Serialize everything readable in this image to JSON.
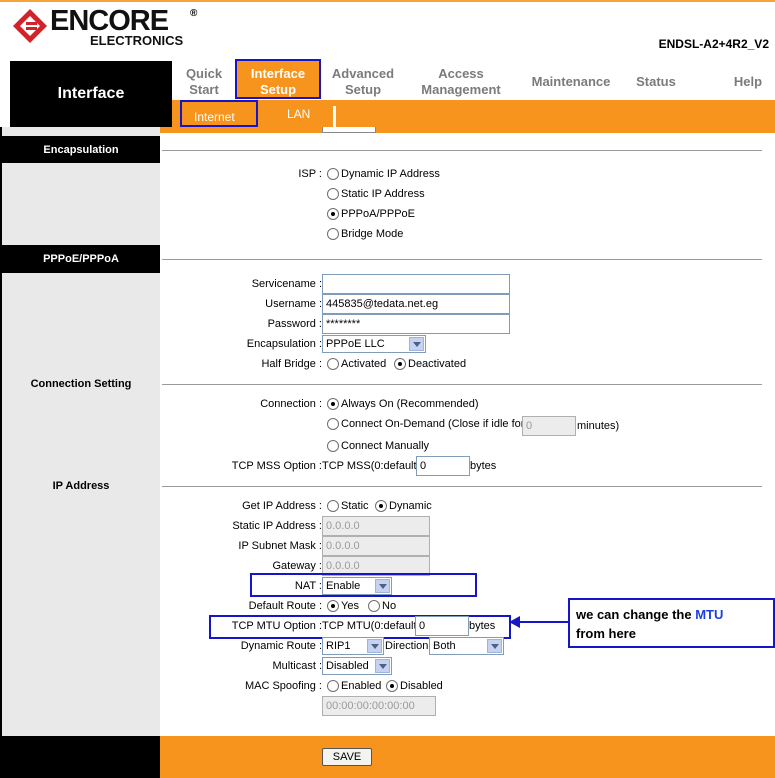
{
  "header": {
    "logo_main": "ENCORE",
    "logo_sub": "ELECTRONICS",
    "logo_reg": "®",
    "model": "ENDSL-A2+4R2_V2"
  },
  "nav": {
    "section_title": "Interface",
    "items": [
      {
        "label1": "Quick",
        "label2": "Start"
      },
      {
        "label1": "Interface",
        "label2": "Setup"
      },
      {
        "label1": "Advanced",
        "label2": "Setup"
      },
      {
        "label1": "Access",
        "label2": "Management"
      },
      {
        "label1": "Maintenance",
        "label2": ""
      },
      {
        "label1": "Status",
        "label2": ""
      },
      {
        "label1": "Help",
        "label2": ""
      }
    ],
    "subitems": [
      "Internet",
      "LAN"
    ]
  },
  "sections": {
    "encapsulation": "Encapsulation",
    "pppoe": "PPPoE/PPPoA",
    "connection_setting": "Connection Setting",
    "ip_address": "IP Address"
  },
  "isp": {
    "label": "ISP :",
    "options": [
      "Dynamic IP Address",
      "Static IP Address",
      "PPPoA/PPPoE",
      "Bridge Mode"
    ],
    "selected": "PPPoA/PPPoE"
  },
  "pppoe": {
    "servicename_label": "Servicename :",
    "servicename_value": "",
    "username_label": "Username :",
    "username_value": "445835@tedata.net.eg",
    "password_label": "Password :",
    "password_value": "********",
    "encap_label": "Encapsulation :",
    "encap_value": "PPPoE LLC",
    "halfbridge_label": "Half Bridge :",
    "halfbridge_options": [
      "Activated",
      "Deactivated"
    ],
    "halfbridge_selected": "Deactivated"
  },
  "connection": {
    "label": "Connection :",
    "always_on": "Always On (Recommended)",
    "on_demand_pre": "Connect On-Demand (Close if idle for",
    "on_demand_value": "0",
    "on_demand_post": "minutes)",
    "manual": "Connect Manually",
    "selected": "Always On (Recommended)",
    "mss_label": "TCP MSS Option :",
    "mss_pre": "TCP MSS(0:default)",
    "mss_value": "0",
    "mss_unit": "bytes"
  },
  "ip": {
    "get_ip_label": "Get IP Address :",
    "get_ip_options": [
      "Static",
      "Dynamic"
    ],
    "get_ip_selected": "Dynamic",
    "static_ip_label": "Static IP Address :",
    "static_ip_value": "0.0.0.0",
    "subnet_label": "IP Subnet Mask :",
    "subnet_value": "0.0.0.0",
    "gateway_label": "Gateway :",
    "gateway_value": "0.0.0.0",
    "nat_label": "NAT :",
    "nat_value": "Enable",
    "default_route_label": "Default Route :",
    "default_route_options": [
      "Yes",
      "No"
    ],
    "default_route_selected": "Yes",
    "mtu_label": "TCP MTU Option :",
    "mtu_pre": "TCP MTU(0:default)",
    "mtu_value": "0",
    "mtu_unit": "bytes",
    "dyn_route_label": "Dynamic Route :",
    "dyn_route_value": "RIP1",
    "direction_label": "Direction",
    "direction_value": "Both",
    "multicast_label": "Multicast :",
    "multicast_value": "Disabled",
    "mac_label": "MAC Spoofing :",
    "mac_options": [
      "Enabled",
      "Disabled"
    ],
    "mac_selected": "Disabled",
    "mac_value": "00:00:00:00:00:00"
  },
  "callout": {
    "line1": "we can change the",
    "highlight": "MTU",
    "line2": "from here"
  },
  "footer": {
    "save_label": "SAVE"
  },
  "colors": {
    "orange": "#f7941d",
    "highlight_blue": "#1616c8",
    "black": "#000000"
  }
}
